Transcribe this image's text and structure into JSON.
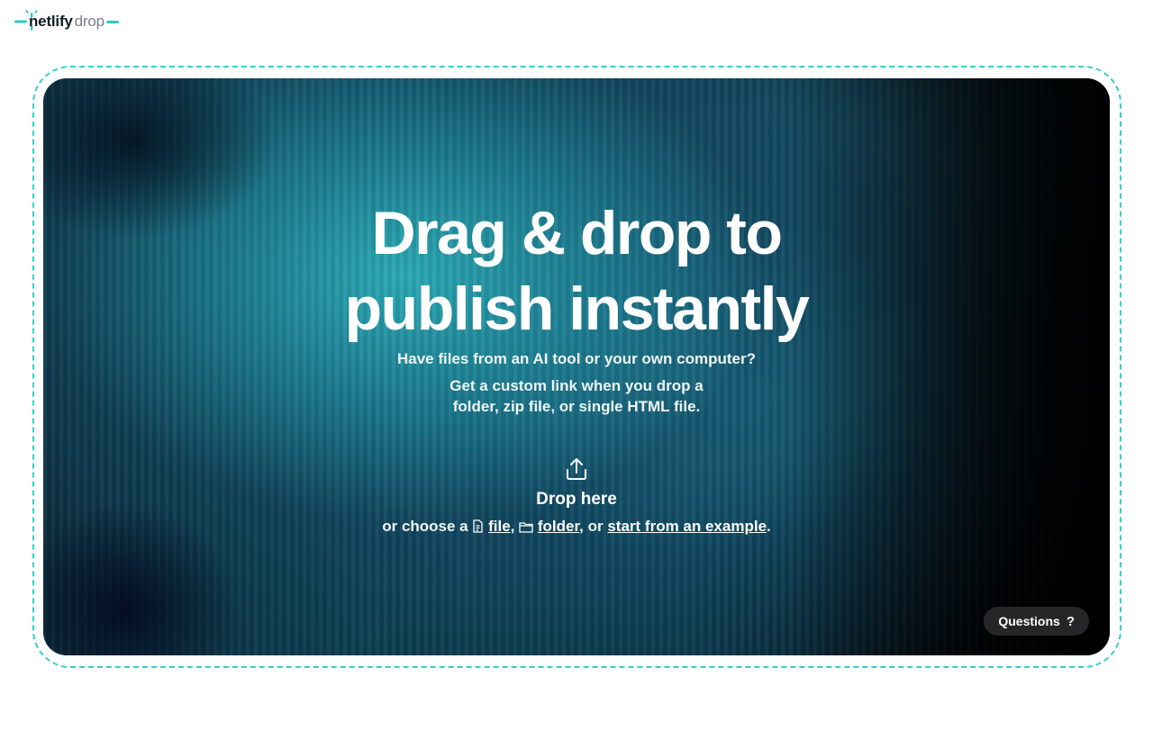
{
  "brand": {
    "name": "netlify",
    "product": "drop",
    "accent_color": "#30c8c9"
  },
  "hero": {
    "title_line1": "Drag & drop to",
    "title_line2": "publish instantly",
    "subtitle": "Have files from an AI tool or your own computer?",
    "description_line1": "Get a custom link when you drop a",
    "description_line2": "folder, zip file, or single HTML file."
  },
  "dropzone": {
    "icon": "upload-icon",
    "label": "Drop here",
    "choose_prefix": "or choose a",
    "file_link": "file",
    "folder_link": "folder",
    "or_text": ", or",
    "example_link": "start from an example",
    "period": ".",
    "border_color": "#35cfd0"
  },
  "help": {
    "questions_label": "Questions",
    "questions_icon": "?"
  }
}
